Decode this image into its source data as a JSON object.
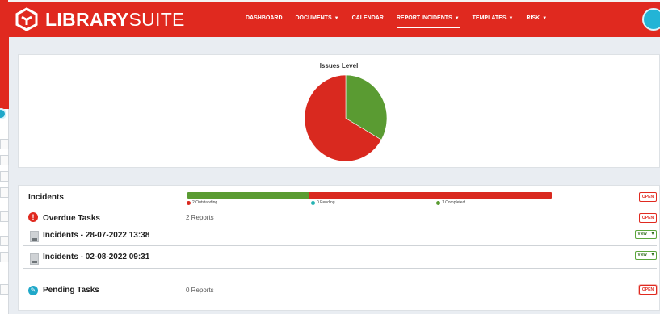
{
  "brand": {
    "bold": "LIBRARY",
    "light": "SUITE"
  },
  "nav": [
    {
      "label": "DASHBOARD",
      "caret": false,
      "active": false
    },
    {
      "label": "DOCUMENTS",
      "caret": true,
      "active": false
    },
    {
      "label": "CALENDAR",
      "caret": false,
      "active": false
    },
    {
      "label": "REPORT INCIDENTS",
      "caret": true,
      "active": true
    },
    {
      "label": "TEMPLATES",
      "caret": true,
      "active": false
    },
    {
      "label": "RISK",
      "caret": true,
      "active": false
    }
  ],
  "colors": {
    "brand": "#e0291f",
    "green": "#5a9b32",
    "red": "#d9291f",
    "teal": "#26b3b3"
  },
  "chart_data": {
    "type": "pie",
    "title": "Issues Level",
    "slices": [
      {
        "label": "Outstanding",
        "value": 2,
        "color": "#d9291f"
      },
      {
        "label": "Completed",
        "value": 1,
        "color": "#5a9b32"
      }
    ]
  },
  "incidents": {
    "title": "Incidents",
    "open_label": "OPEN",
    "progress": {
      "segments": [
        {
          "label": "Completed",
          "fraction": 0.333,
          "color": "#5a9b32"
        },
        {
          "label": "Outstanding",
          "fraction": 0.667,
          "color": "#d9291f"
        }
      ]
    },
    "legend": [
      {
        "text": "2 Outstanding",
        "color": "#d9291f"
      },
      {
        "text": "0 Pending",
        "color": "#26b3b3"
      },
      {
        "text": "1 Completed",
        "color": "#5a9b32"
      }
    ]
  },
  "overdue": {
    "title": "Overdue Tasks",
    "count_text": "2 Reports",
    "open_label": "OPEN",
    "icon": "alert-icon",
    "items": [
      {
        "title": "Incidents - 28-07-2022 13:38",
        "view_label": "View",
        "dropdown": "▾"
      },
      {
        "title": "Incidents - 02-08-2022 09:31",
        "view_label": "View",
        "dropdown": "▾"
      }
    ]
  },
  "pending": {
    "title": "Pending Tasks",
    "count_text": "0 Reports",
    "open_label": "OPEN",
    "icon": "pencil-icon"
  }
}
